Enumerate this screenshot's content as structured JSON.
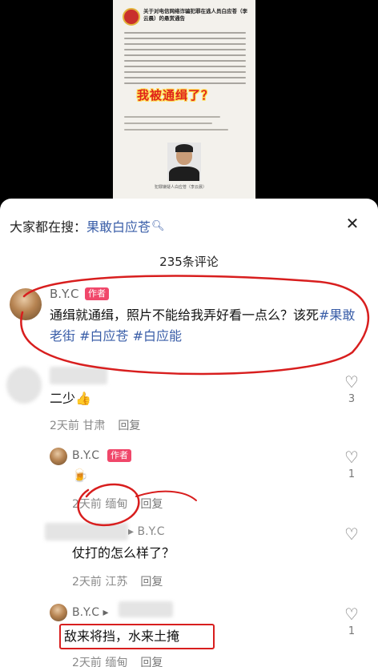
{
  "poster": {
    "title": "关于对电信网络诈骗犯罪在逃人员白应苍（李云晨）的悬赏通告",
    "stamp": "我被通缉了？",
    "caption": "犯罪嫌疑人白应苍（李云晨）"
  },
  "search": {
    "prefix": "大家都在搜：",
    "keyword": "果敢白应苍",
    "icon": "search-icon"
  },
  "close_icon": "close-icon",
  "comments_count": "235条评论",
  "comments": [
    {
      "name": "B.Y.C",
      "badge": "作者",
      "text_plain": "通缉就通缉，照片不能给我弄好看一点么？该死",
      "tags": [
        "#果敢老街",
        "#白应苍",
        "#白应能"
      ]
    },
    {
      "text": "二少👍",
      "time": "2天前",
      "location": "甘肃",
      "reply": "回复",
      "likes": "3"
    },
    {
      "name": "B.Y.C",
      "badge": "作者",
      "text": "🍺",
      "time": "2天前",
      "location": "缅甸",
      "reply": "回复",
      "likes": "1"
    },
    {
      "reply_to": "B.Y.C",
      "text": "仗打的怎么样了？",
      "time": "2天前",
      "location": "江苏",
      "reply": "回复"
    },
    {
      "name": "B.Y.C",
      "text": "敌来将挡，水来土掩",
      "time": "2天前",
      "location": "缅甸",
      "reply": "回复",
      "likes": "1"
    }
  ],
  "colors": {
    "accent": "#3a5ea8",
    "badge": "#f0476a",
    "annotation": "#d81e1e"
  }
}
